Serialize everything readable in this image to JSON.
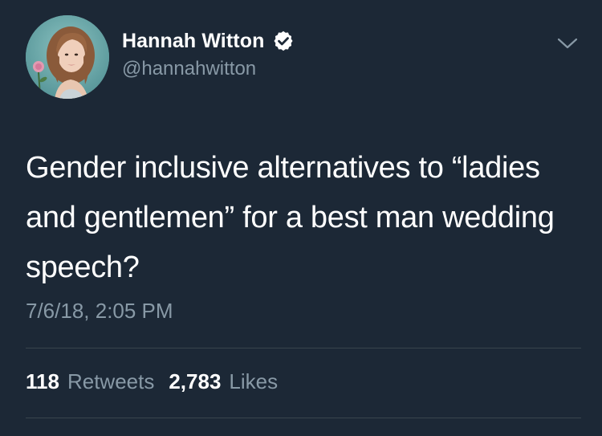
{
  "author": {
    "display_name": "Hannah Witton",
    "handle": "@hannahwitton",
    "verified": true,
    "avatar_icon": "profile-photo"
  },
  "tweet": {
    "text": "Gender inclusive alternatives to “ladies and gentlemen” for a best man wedding speech?",
    "timestamp": "7/6/18, 2:05 PM"
  },
  "stats": {
    "retweets_count": "118",
    "retweets_label": "Retweets",
    "likes_count": "2,783",
    "likes_label": "Likes"
  },
  "icons": {
    "verified": "verified-badge-icon",
    "menu": "chevron-down-icon"
  },
  "colors": {
    "background": "#1c2836",
    "primary_text": "#ffffff",
    "secondary_text": "#8899a6",
    "divider": "#38444d"
  }
}
